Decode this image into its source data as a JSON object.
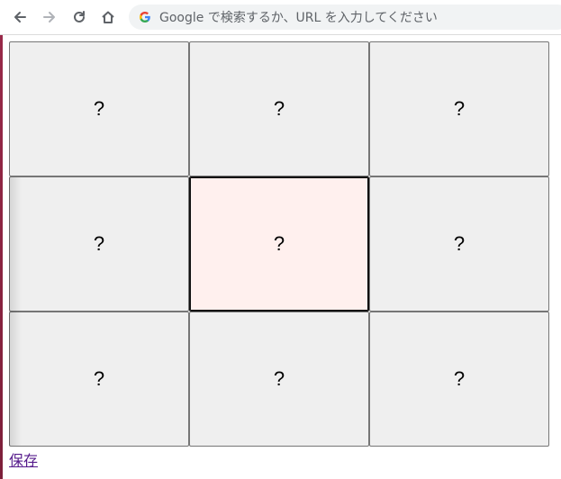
{
  "browser": {
    "omnibox_placeholder": "Google で検索するか、URL を入力してください"
  },
  "grid": {
    "cells": [
      "?",
      "?",
      "?",
      "?",
      "?",
      "?",
      "?",
      "?",
      "?"
    ],
    "focused_index": 4
  },
  "footer": {
    "save_label": "保存"
  }
}
